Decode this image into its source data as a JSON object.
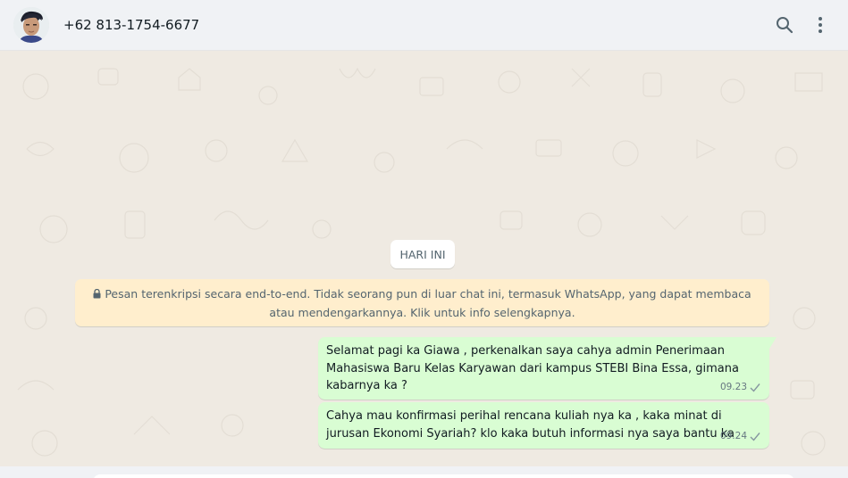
{
  "header": {
    "contact_name": "+62 813-1754-6677",
    "avatar_icon": "user-avatar",
    "search_icon": "search-icon",
    "menu_icon": "more-vertical-icon"
  },
  "chat": {
    "date_label": "HARI INI",
    "encryption_notice": "Pesan terenkripsi secara end-to-end. Tidak seorang pun di luar chat ini, termasuk WhatsApp, yang dapat membaca atau mendengarkannya. Klik untuk info selengkapnya.",
    "messages": [
      {
        "text": "Selamat pagi ka Giawa , perkenalkan saya cahya admin Penerimaan Mahasiswa Baru Kelas Karyawan dari kampus STEBI Bina Essa, gimana kabarnya ka ?",
        "time": "09.23",
        "status_icon": "single-check-icon"
      },
      {
        "text": "Cahya mau konfirmasi perihal rencana kuliah nya ka , kaka minat di jurusan Ekonomi Syariah?  klo kaka butuh informasi nya saya bantu ka",
        "time": "09.24",
        "status_icon": "single-check-icon"
      }
    ]
  },
  "colors": {
    "outgoing_bubble": "#d9fdd3",
    "chat_background": "#efeae2",
    "header_background": "#f0f2f5",
    "notice_background": "#ffeecd"
  }
}
